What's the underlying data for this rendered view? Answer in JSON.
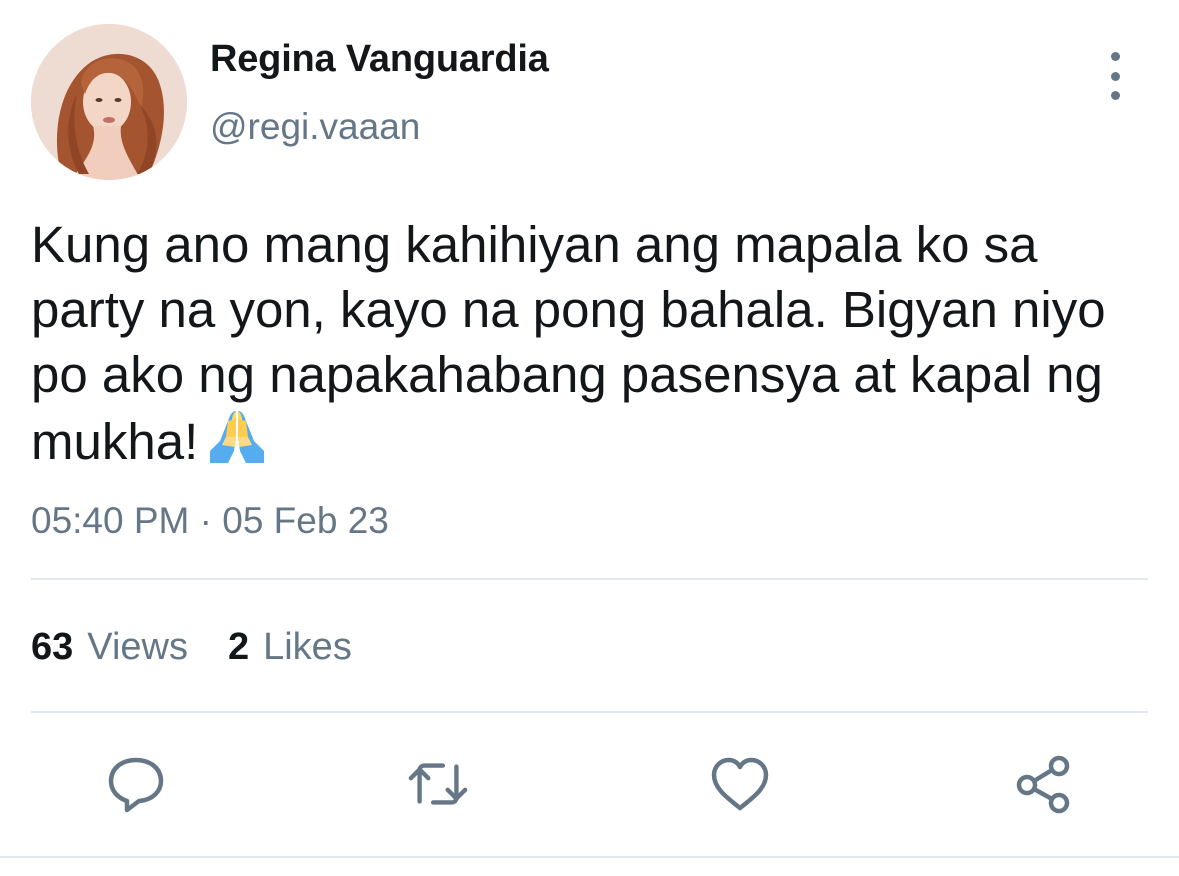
{
  "author": {
    "display_name": "Regina Vanguardia",
    "handle": "@regi.vaaan"
  },
  "tweet": {
    "text": "Kung ano mang kahihiyan ang mapala ko sa party na yon, kayo na pong bahala. Bigyan niyo po ako ng napakahabang pasensya at kapal ng mukha!",
    "emoji": "🙏",
    "timestamp": "05:40 PM · 05 Feb 23"
  },
  "stats": {
    "views_count": "63",
    "views_label": "Views",
    "likes_count": "2",
    "likes_label": "Likes"
  },
  "actions": {
    "icons": [
      "reply-icon",
      "retweet-icon",
      "like-icon",
      "share-icon"
    ]
  },
  "colors": {
    "text_primary": "#14171a",
    "text_secondary": "#657786",
    "divider": "#e1e8ed"
  }
}
